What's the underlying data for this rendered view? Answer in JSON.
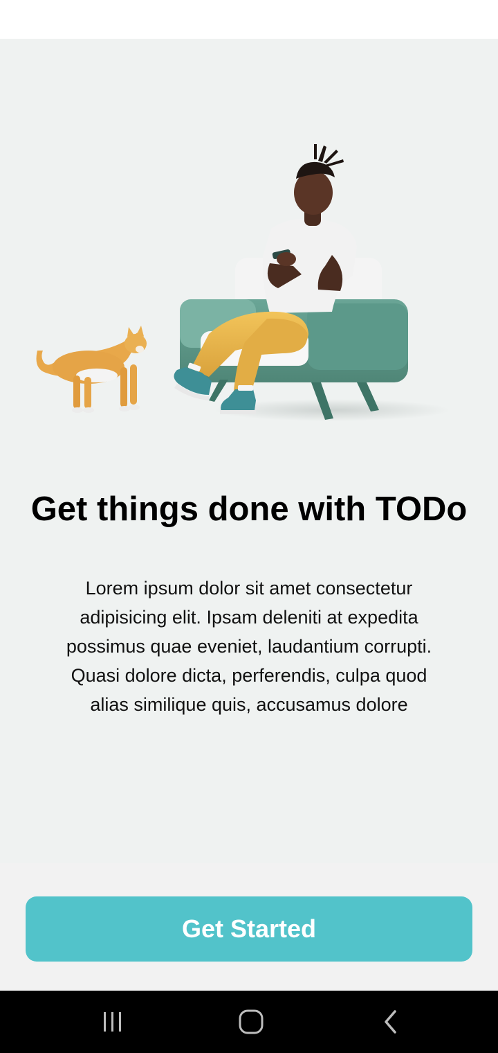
{
  "onboarding": {
    "title": "Get things done with TODo",
    "description": "Lorem ipsum dolor sit amet consectetur adipisicing elit. Ipsam deleniti at expedita possimus quae eveniet, laudantium corrupti. Quasi dolore dicta, perferendis, culpa quod alias similique quis, accusamus dolore",
    "illustration_icon": "person-on-armchair-with-cat-illustration"
  },
  "actions": {
    "get_started_label": "Get Started"
  },
  "navigation_bar": {
    "recents_icon": "recents-icon",
    "home_icon": "home-icon",
    "back_icon": "back-icon"
  },
  "colors": {
    "accent": "#52c3ca",
    "content_background": "#eff2f1",
    "navbar_background": "#000000"
  }
}
